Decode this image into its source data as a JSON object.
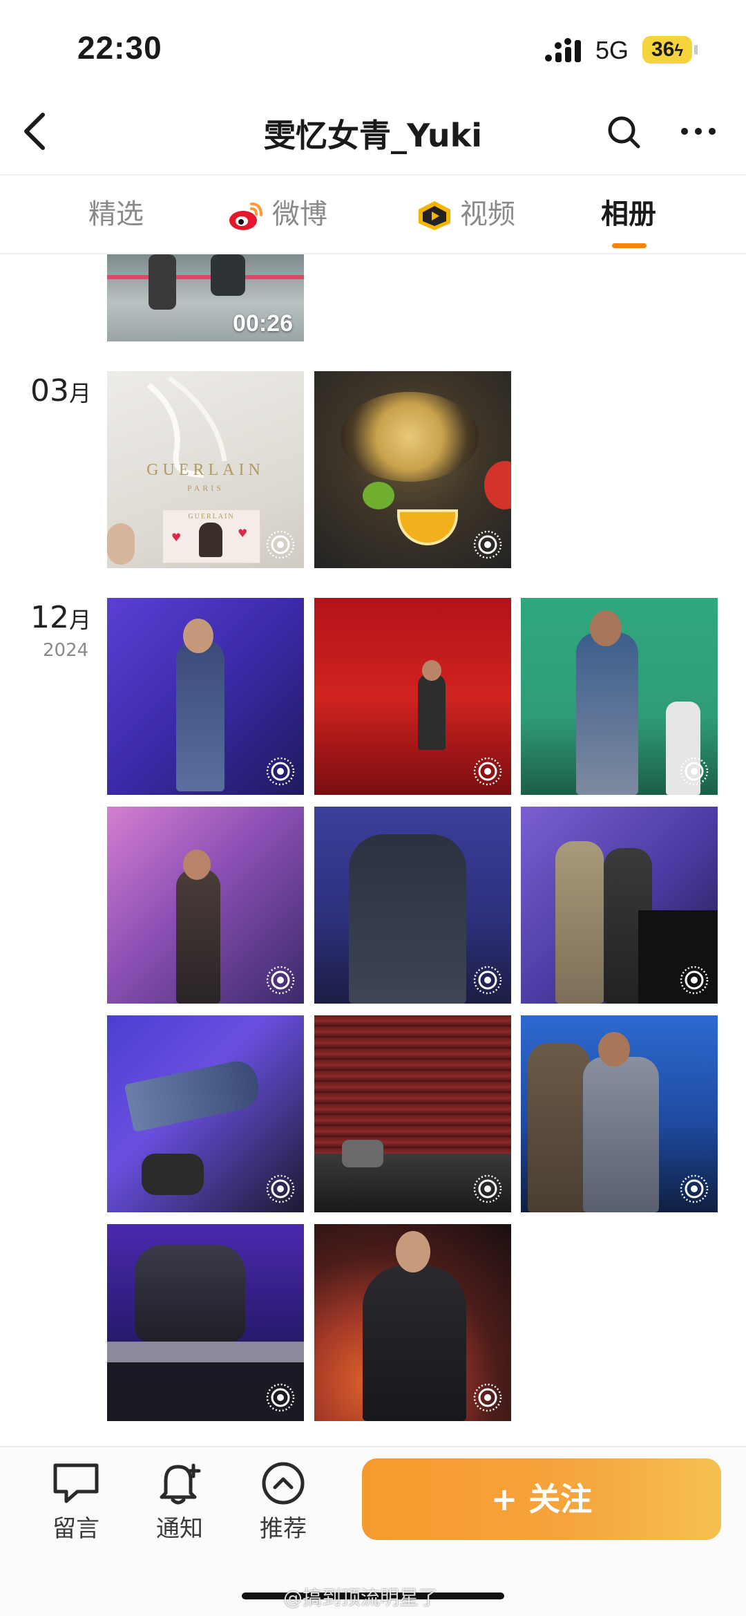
{
  "status_bar": {
    "time": "22:30",
    "network": "5G",
    "battery": "36",
    "colors": {
      "battery": "#f5d33c"
    }
  },
  "nav": {
    "title": "雯忆女青_Yuki",
    "icons": [
      "back-icon",
      "search-icon",
      "more-icon"
    ]
  },
  "tabs": [
    {
      "label": "精选",
      "icon": null,
      "active": false
    },
    {
      "label": "微博",
      "icon": "weibo-icon",
      "active": false
    },
    {
      "label": "视频",
      "icon": "video-badge-icon",
      "active": false
    },
    {
      "label": "相册",
      "icon": null,
      "active": true
    }
  ],
  "accent_color": "#ff8200",
  "album": {
    "top_video": {
      "duration": "00:26"
    },
    "groups": [
      {
        "month": "03",
        "month_unit": "月",
        "year": "",
        "items": [
          {
            "subject": "guerlain-bag",
            "live": true,
            "brand_text": "GUERLAIN",
            "brand_sub": "PARIS"
          },
          {
            "subject": "sea-urchin-dish",
            "live": true
          }
        ]
      },
      {
        "month": "12",
        "month_unit": "月",
        "year": "2024",
        "items": [
          {
            "subject": "concert-purple",
            "live": true
          },
          {
            "subject": "concert-red",
            "live": true
          },
          {
            "subject": "concert-green",
            "live": true
          },
          {
            "subject": "concert-pink",
            "live": true
          },
          {
            "subject": "concert-blue",
            "live": true
          },
          {
            "subject": "concert-duo",
            "live": true
          },
          {
            "subject": "concert-rotated",
            "live": true
          },
          {
            "subject": "concert-arena",
            "live": true
          },
          {
            "subject": "concert-dance",
            "live": true
          },
          {
            "subject": "concert-sitting",
            "live": true
          },
          {
            "subject": "concert-black",
            "live": true
          }
        ]
      }
    ]
  },
  "bottom_bar": {
    "actions": [
      {
        "label": "留言",
        "icon": "message-icon"
      },
      {
        "label": "通知",
        "icon": "bell-plus-icon"
      },
      {
        "label": "推荐",
        "icon": "chevron-up-circle-icon"
      }
    ],
    "follow_label": "+ 关注",
    "follow_colors": [
      "#f79a2e",
      "#f6c04f"
    ]
  },
  "watermark": "@搞到顶流明星了"
}
